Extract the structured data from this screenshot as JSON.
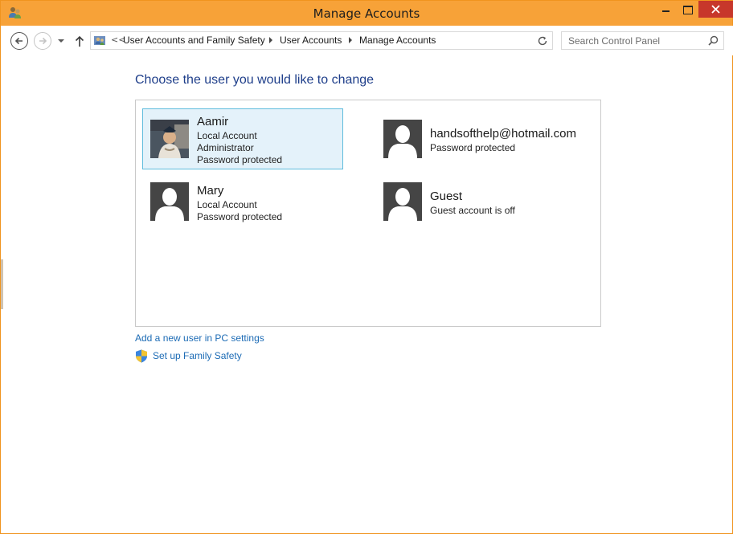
{
  "window": {
    "title": "Manage Accounts"
  },
  "address_bar": {
    "lead": "<<",
    "breadcrumbs": [
      "User Accounts and Family Safety",
      "User Accounts",
      "Manage Accounts"
    ]
  },
  "search": {
    "placeholder": "Search Control Panel"
  },
  "main": {
    "heading": "Choose the user you would like to change",
    "accounts": [
      {
        "name": "Aamir",
        "lines": [
          "Local Account",
          "Administrator",
          "Password protected"
        ],
        "avatar": "photo",
        "selected": true
      },
      {
        "name": "handsofthelp@hotmail.com",
        "lines": [
          "Password protected"
        ],
        "avatar": "default-user-icon",
        "selected": false
      },
      {
        "name": "Mary",
        "lines": [
          "Local Account",
          "Password protected"
        ],
        "avatar": "default-user-icon",
        "selected": false
      },
      {
        "name": "Guest",
        "lines": [
          "Guest account is off"
        ],
        "avatar": "default-user-icon",
        "selected": false
      }
    ],
    "links": {
      "add_user": "Add a new user in PC settings",
      "family_safety": "Set up Family Safety"
    }
  },
  "colors": {
    "titlebar": "#f7a238",
    "close_button": "#c7372b",
    "heading": "#1e3e8a",
    "link": "#1c6bb5",
    "selected_bg": "#e4f2fa",
    "selected_border": "#5fbcdd"
  }
}
